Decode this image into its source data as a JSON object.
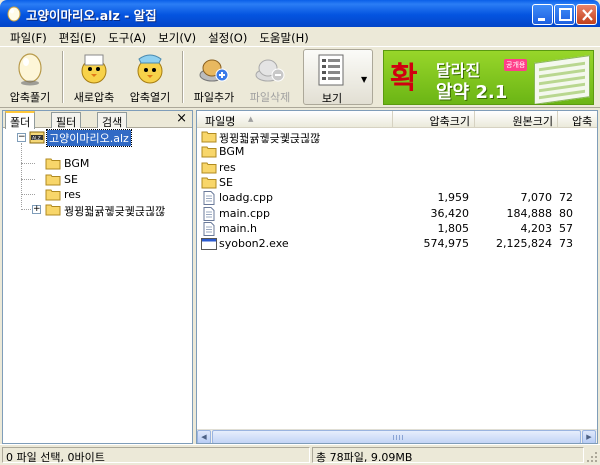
{
  "window": {
    "title": "고양이마리오.alz - 알집",
    "minimize_icon": "minimize-icon",
    "maximize_icon": "maximize-icon",
    "close_icon": "close-icon"
  },
  "menu": [
    "파일(F)",
    "편집(E)",
    "도구(A)",
    "보기(V)",
    "설정(O)",
    "도움말(H)"
  ],
  "toolbar": {
    "extract": "압축풀기",
    "new_archive": "새로압축",
    "open_archive": "압축열기",
    "add_file": "파일추가",
    "delete_file": "파일삭제",
    "view": "보기"
  },
  "banner": {
    "big": "확",
    "line1": "달라진",
    "badge": "공개용",
    "line2": "알약 2.1"
  },
  "left_tabs": [
    "폴더",
    "필터",
    "검색"
  ],
  "tree": {
    "root": "고양이마리오.alz",
    "children": [
      "BGM",
      "SE",
      "res",
      "꿩뀡꿟귥궿긎궻귽긚깒"
    ]
  },
  "list": {
    "headers": [
      "파일명",
      "압축크기",
      "원본크기",
      "압축"
    ],
    "rows": [
      {
        "name": "꿩뀡꿟귥궿긎궻귽긚깒",
        "type": "folder",
        "packed": "",
        "original": "",
        "ratio": ""
      },
      {
        "name": "BGM",
        "type": "folder",
        "packed": "",
        "original": "",
        "ratio": ""
      },
      {
        "name": "res",
        "type": "folder",
        "packed": "",
        "original": "",
        "ratio": ""
      },
      {
        "name": "SE",
        "type": "folder",
        "packed": "",
        "original": "",
        "ratio": ""
      },
      {
        "name": "loadg.cpp",
        "type": "file",
        "packed": "1,959",
        "original": "7,070",
        "ratio": "72"
      },
      {
        "name": "main.cpp",
        "type": "file",
        "packed": "36,420",
        "original": "184,888",
        "ratio": "80"
      },
      {
        "name": "main.h",
        "type": "file",
        "packed": "1,805",
        "original": "4,203",
        "ratio": "57"
      },
      {
        "name": "syobon2.exe",
        "type": "exe",
        "packed": "574,975",
        "original": "2,125,824",
        "ratio": "73"
      }
    ]
  },
  "status": {
    "left": "0 파일 선택, 0바이트",
    "right": "총 78파일, 9.09MB"
  }
}
